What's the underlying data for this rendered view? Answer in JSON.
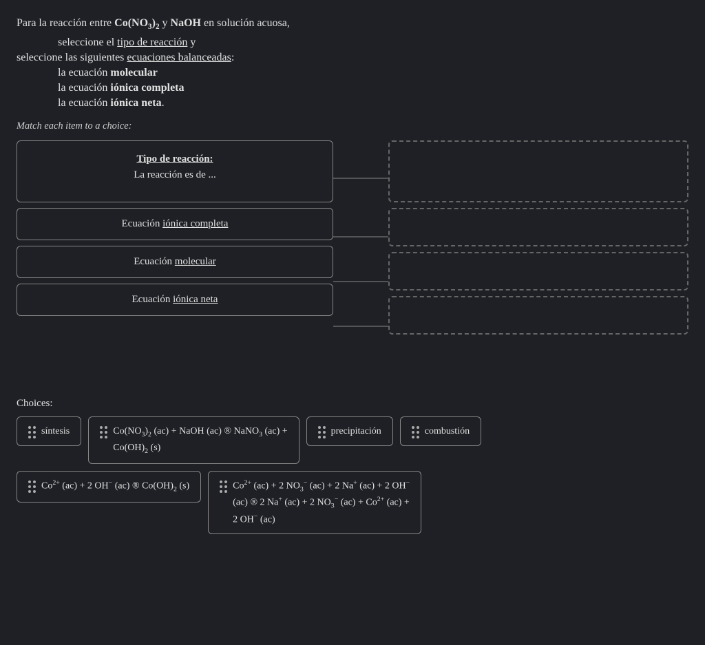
{
  "intro": {
    "line1_pre": "Para la reacción entre ",
    "line1_compound1": "Co(NO",
    "line1_compound1_sub": "3",
    "line1_compound1_post": ")",
    "line1_compound1_sub2": "2",
    "line1_mid": " y ",
    "line1_compound2": "NaOH",
    "line1_post": " en solución acuosa,",
    "line2": "seleccione el tipo de reacción y",
    "line3": "seleccione las siguientes ecuaciones balanceadas:",
    "line4": "la ecuación molecular",
    "line5": "la ecuación iónica completa",
    "line6": "la ecuación iónica neta.",
    "tipo_label": "tipo de reacción",
    "ecuaciones_label": "ecuaciones balanceadas",
    "molecular_label": "molecular",
    "ionica_completa_label": "iónica completa",
    "ionica_neta_label": "iónica neta"
  },
  "match_label": "Match each item to a choice:",
  "left_items": [
    {
      "id": "tipo",
      "line1": "Tipo de reacción:",
      "line2": "La reacción es de ..."
    },
    {
      "id": "ionica-completa",
      "label": "Ecuación iónica completa"
    },
    {
      "id": "molecular",
      "label": "Ecuación molecular"
    },
    {
      "id": "ionica-neta",
      "label": "Ecuación iónica neta"
    }
  ],
  "choices_label": "Choices:",
  "choices": [
    {
      "id": "sintesis",
      "label": "síntesis"
    },
    {
      "id": "equation1",
      "label": "Co(NO₃)₂ (ac) + NaOH (ac) ® NaNO₃ (ac) + Co(OH)₂ (s)"
    },
    {
      "id": "precipitacion",
      "label": "precipitación"
    },
    {
      "id": "combustion",
      "label": "combustión"
    },
    {
      "id": "equation2",
      "label": "Co²⁺ (ac) + 2 OH⁻ (ac) ® Co(OH)₂ (s)"
    },
    {
      "id": "equation3",
      "label": "Co²⁺ (ac) + 2 NO₃⁻ (ac) + 2 Na⁺ (ac) + 2 OH⁻ (ac) ® 2 Na⁺ (ac) + 2 NO₃⁻ (ac) + Co²⁺ (ac) + 2 OH⁻ (ac)"
    }
  ]
}
